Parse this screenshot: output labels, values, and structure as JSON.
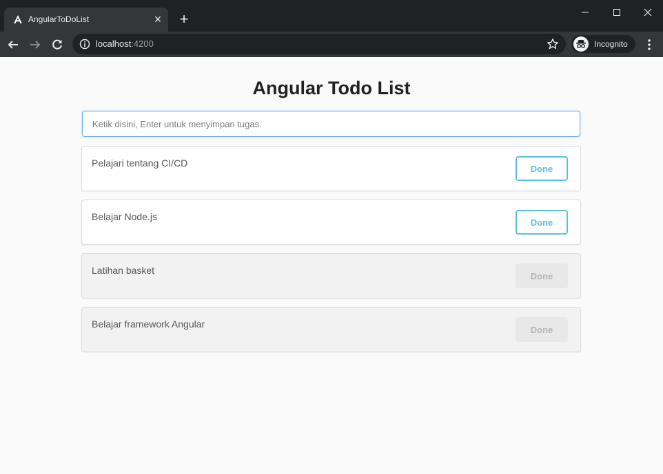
{
  "browser": {
    "tab": {
      "title": "AngularToDoList"
    },
    "address": {
      "host": "localhost",
      "port": ":4200"
    },
    "incognito_label": "Incognito"
  },
  "page": {
    "title": "Angular Todo List",
    "input": {
      "placeholder": "Ketik disini, Enter untuk menyimpan tugas.",
      "value": ""
    },
    "todos": [
      {
        "text": "Pelajari tentang CI/CD",
        "button": "Done",
        "completed": false
      },
      {
        "text": "Belajar Node.js",
        "button": "Done",
        "completed": false
      },
      {
        "text": "Latihan basket",
        "button": "Done",
        "completed": true
      },
      {
        "text": "Belajar framework Angular",
        "button": "Done",
        "completed": true
      }
    ]
  },
  "colors": {
    "accent": "#5bc0de",
    "input_focus_border": "#66afe9",
    "chrome_dark": "#202124",
    "chrome_toolbar": "#35363a"
  }
}
